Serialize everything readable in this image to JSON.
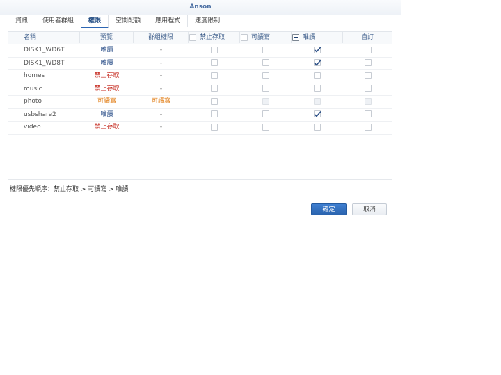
{
  "window": {
    "title": "Anson"
  },
  "tabs": [
    {
      "label": "資訊",
      "active": false
    },
    {
      "label": "使用者群組",
      "active": false
    },
    {
      "label": "權限",
      "active": true
    },
    {
      "label": "空間配額",
      "active": false
    },
    {
      "label": "應用程式",
      "active": false
    },
    {
      "label": "速度限制",
      "active": false
    }
  ],
  "table": {
    "headers": {
      "name": "名稱",
      "preview": "預覽",
      "group": "群組權限",
      "deny": "禁止存取",
      "rw": "可讀寫",
      "ro": "唯讀",
      "custom": "自訂"
    },
    "header_checks": {
      "deny": "unchecked",
      "rw": "unchecked",
      "ro": "indeterminate"
    },
    "rows": [
      {
        "name": "DISK1_WD6T",
        "preview": "唯讀",
        "preview_type": "read",
        "group": "-",
        "deny": false,
        "rw": false,
        "ro": true,
        "custom": false,
        "disabled": false
      },
      {
        "name": "DISK1_WD8T",
        "preview": "唯讀",
        "preview_type": "read",
        "group": "-",
        "deny": false,
        "rw": false,
        "ro": true,
        "custom": false,
        "disabled": false
      },
      {
        "name": "homes",
        "preview": "禁止存取",
        "preview_type": "deny",
        "group": "-",
        "deny": false,
        "rw": false,
        "ro": false,
        "custom": false,
        "disabled": false
      },
      {
        "name": "music",
        "preview": "禁止存取",
        "preview_type": "deny",
        "group": "-",
        "deny": false,
        "rw": false,
        "ro": false,
        "custom": false,
        "disabled": false
      },
      {
        "name": "photo",
        "preview": "可讀寫",
        "preview_type": "rw",
        "group": "可讀寫",
        "group_type": "rw",
        "deny": false,
        "rw": false,
        "ro": false,
        "custom": false,
        "disabled": true
      },
      {
        "name": "usbshare2",
        "preview": "唯讀",
        "preview_type": "read",
        "group": "-",
        "deny": false,
        "rw": false,
        "ro": true,
        "custom": false,
        "disabled": false
      },
      {
        "name": "video",
        "preview": "禁止存取",
        "preview_type": "deny",
        "group": "-",
        "deny": false,
        "rw": false,
        "ro": false,
        "custom": false,
        "disabled": false
      }
    ]
  },
  "footer": {
    "priority_note": "權限優先順序：禁止存取 > 可讀寫 > 唯讀"
  },
  "buttons": {
    "ok": "確定",
    "cancel": "取消"
  },
  "colors": {
    "read": "#264b86",
    "deny": "#c4261b",
    "rw": "#e07a10",
    "primary": "#2a63ae"
  },
  "icons": {
    "check": "check-mark-icon"
  }
}
